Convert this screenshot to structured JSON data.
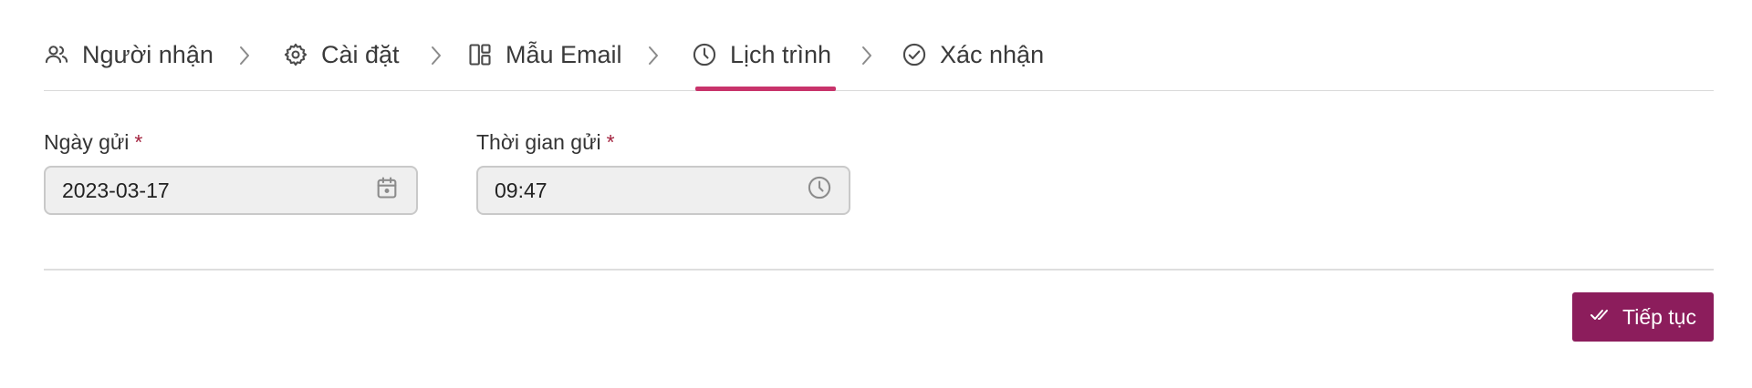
{
  "stepper": {
    "steps": [
      {
        "label": "Người nhận",
        "icon": "users-icon"
      },
      {
        "label": "Cài đặt",
        "icon": "gear-icon"
      },
      {
        "label": "Mẫu Email",
        "icon": "layout-template-icon"
      },
      {
        "label": "Lịch trình",
        "icon": "clock-icon",
        "active": true
      },
      {
        "label": "Xác nhận",
        "icon": "check-circle-icon"
      }
    ],
    "accent_color": "#c8336b"
  },
  "form": {
    "send_date": {
      "label": "Ngày gửi",
      "required_mark": "*",
      "value": "2023-03-17",
      "icon": "calendar-icon"
    },
    "send_time": {
      "label": "Thời gian gửi",
      "required_mark": "*",
      "value": "09:47",
      "icon": "clock-icon"
    }
  },
  "footer": {
    "continue_label": "Tiếp tục",
    "continue_icon": "double-check-icon",
    "button_color": "#8c1d5c"
  }
}
